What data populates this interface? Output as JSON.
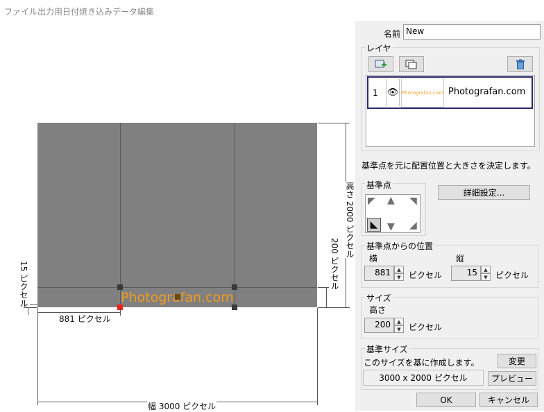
{
  "window": {
    "title": "ファイル出力用日付焼き込みデータ編集"
  },
  "canvas": {
    "overlay_text": "Photografan.com",
    "dim_width_label": "幅 3000 ピクセル",
    "dim_height_label": "高さ 2000 ピクセル",
    "dim_x_label": "881 ピクセル",
    "dim_y_label": "15 ピクセル",
    "dim_size_label": "200 ピクセル"
  },
  "panel": {
    "name_label": "名前",
    "name_value": "New",
    "layer_group": "レイヤ",
    "layers": [
      {
        "index": "1",
        "thumb_text": "Photografan.com",
        "name": "Photografan.com"
      }
    ],
    "hint": "基準点を元に配置位置と大きさを決定します。",
    "anchor_group": "基準点",
    "detail_button": "詳細設定...",
    "position_group": "基準点からの位置",
    "x_label": "横",
    "x_value": "881",
    "x_unit": "ピクセル",
    "y_label": "縦",
    "y_value": "15",
    "y_unit": "ピクセル",
    "size_group": "サイズ",
    "height_label": "高さ",
    "height_value": "200",
    "height_unit": "ピクセル",
    "base_size_group": "基準サイズ",
    "base_size_hint": "このサイズを基に作成します。",
    "change_button": "変更",
    "base_size_value": "3000 x 2000 ピクセル",
    "preview_button": "プレビュー",
    "ok_button": "OK",
    "cancel_button": "キャンセル"
  },
  "colors": {
    "canvas_bg": "#808080",
    "overlay_text": "#f29b1e",
    "anchor_handle": "#ff1b1b",
    "layer_selected_border": "#2a2a6e"
  }
}
